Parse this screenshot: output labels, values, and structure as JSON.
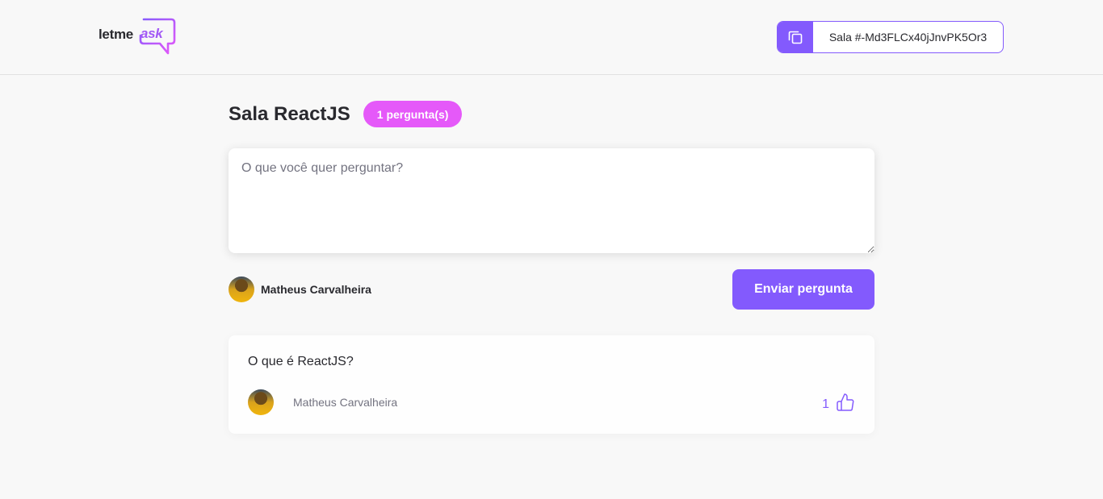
{
  "header": {
    "logo": {
      "letme": "letme",
      "ask": "ask"
    },
    "room_code": {
      "label": "Sala #-Md3FLCx40jJnvPK5Or3",
      "icon": "copy-icon"
    }
  },
  "room": {
    "title": "Sala ReactJS",
    "badge": "1 pergunta(s)"
  },
  "form": {
    "placeholder": "O que você quer perguntar?",
    "value": "",
    "user_name": "Matheus Carvalheira",
    "submit_label": "Enviar pergunta"
  },
  "questions": [
    {
      "content": "O que é ReactJS?",
      "author": "Matheus Carvalheira",
      "likes": "1"
    }
  ],
  "colors": {
    "primary": "#835afd",
    "badge": "#e559f9",
    "background": "#f8f8f8"
  }
}
